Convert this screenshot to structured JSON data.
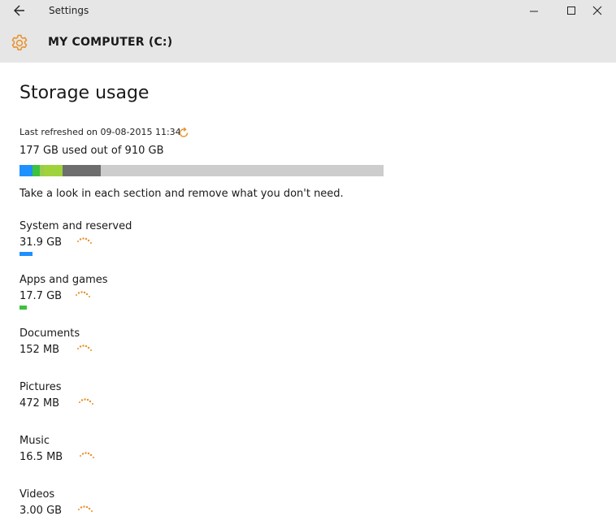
{
  "window": {
    "app_title": "Settings",
    "icons": {
      "back": "back-arrow-icon",
      "minimize": "minimize-icon",
      "maximize": "maximize-icon",
      "close": "close-icon"
    }
  },
  "header": {
    "drive_title": "MY COMPUTER (C:)",
    "icon": "gear-icon",
    "accent_color": "#e8912a"
  },
  "main": {
    "title": "Storage usage",
    "last_refreshed": "Last refreshed on 09-08-2015 11:34",
    "refresh_icon": "refresh-icon",
    "usage_summary": "177 GB used out of 910 GB",
    "usage_bar": {
      "track_color": "#cdcdcd",
      "segments": [
        {
          "fraction": 0.035,
          "color": "#1e90ff"
        },
        {
          "fraction": 0.02,
          "color": "#3cc23c"
        },
        {
          "fraction": 0.012,
          "color": "#9ccc4a"
        },
        {
          "fraction": 0.052,
          "color": "#9fd23b"
        },
        {
          "fraction": 0.104,
          "color": "#6e6e6e"
        }
      ]
    },
    "hint": "Take a look in each section and remove what you don't need.",
    "categories": [
      {
        "name": "System and reserved",
        "size": "31.9 GB",
        "bar_color": "#1e90ff",
        "bar_fraction": 0.035
      },
      {
        "name": "Apps and games",
        "size": "17.7 GB",
        "bar_color": "#3cc23c",
        "bar_fraction": 0.02
      },
      {
        "name": "Documents",
        "size": "152 MB",
        "bar_color": "",
        "bar_fraction": 0
      },
      {
        "name": "Pictures",
        "size": "472 MB",
        "bar_color": "",
        "bar_fraction": 0
      },
      {
        "name": "Music",
        "size": "16.5 MB",
        "bar_color": "",
        "bar_fraction": 0
      },
      {
        "name": "Videos",
        "size": "3.00 GB",
        "bar_color": "",
        "bar_fraction": 0
      }
    ],
    "spinner_color": "#e8912a"
  }
}
